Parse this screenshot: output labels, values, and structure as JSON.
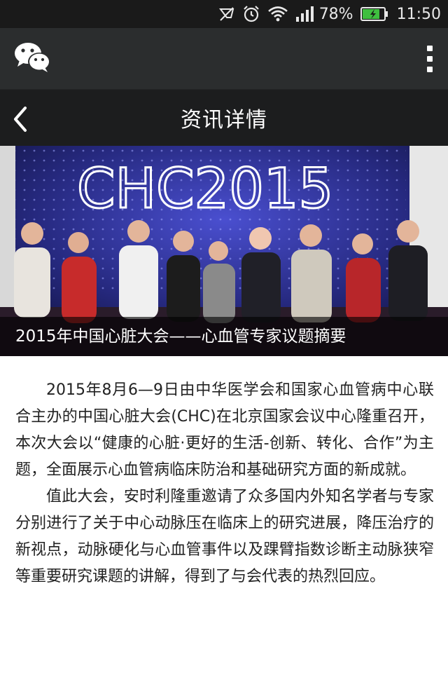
{
  "status_bar": {
    "battery": "78%",
    "time": "11:50"
  },
  "title_bar": {
    "title": "资讯详情"
  },
  "hero": {
    "banner_text": "CHC2015",
    "caption": "2015年中国心脏大会——心血管专家议题摘要"
  },
  "article": {
    "paragraphs": [
      "2015年8月6—9日由中华医学会和国家心血管病中心联合主办的中国心脏大会(CHC)在北京国家会议中心隆重召开，本次大会以“健康的心脏·更好的生活-创新、转化、合作”为主题，全面展示心血管病临床防治和基础研究方面的新成就。",
      "值此大会，安时利隆重邀请了众多国内外知名学者与专家分别进行了关于中心动脉压在临床上的研究进展，降压治疗的新视点，动脉硬化与心血管事件以及踝臂指数诊断主动脉狭窄等重要研究课题的讲解，得到了与会代表的热烈回应。"
    ]
  },
  "colors": {
    "status_bg": "#1a1a1a",
    "appbar_bg": "#2b2d2e",
    "titlebar_bg": "#1c1d1e",
    "battery_fill": "#3fbf3f"
  }
}
